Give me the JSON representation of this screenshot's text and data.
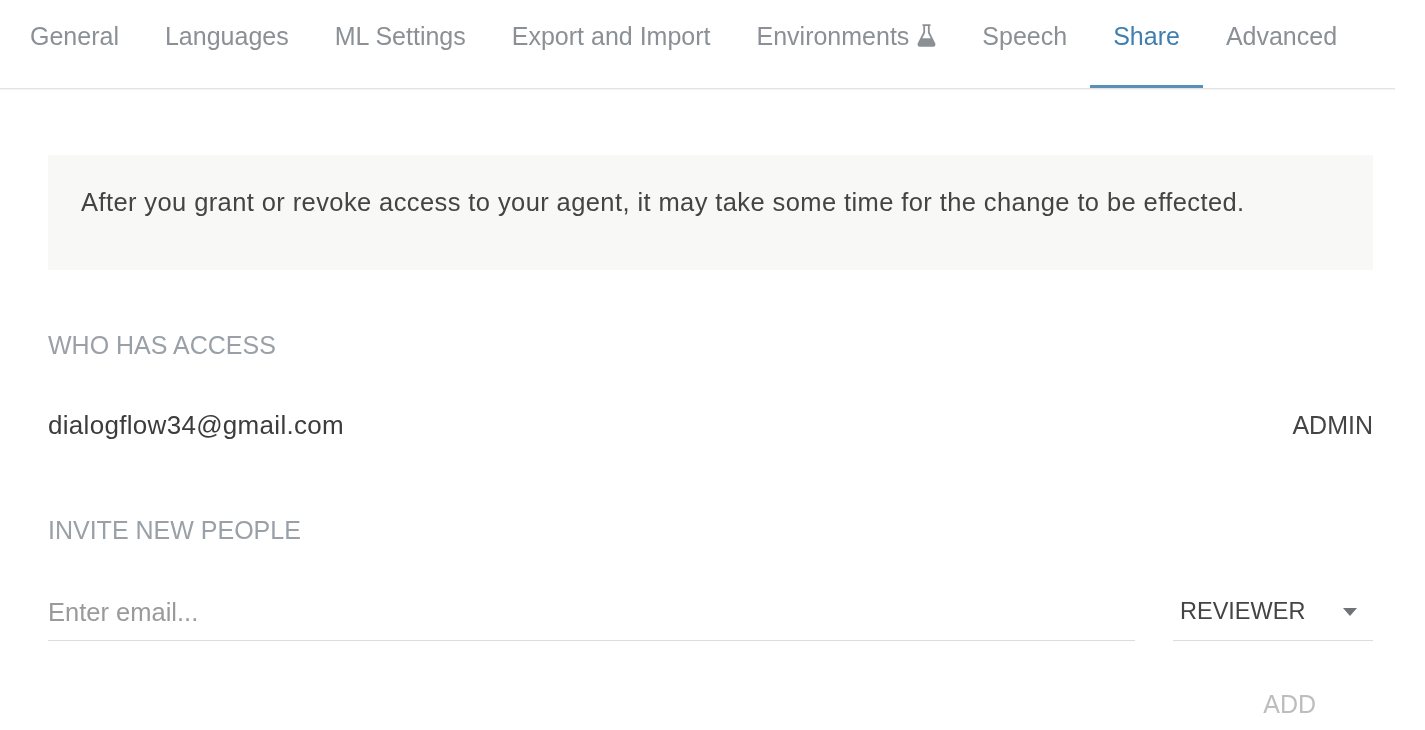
{
  "tabs": [
    {
      "label": "General",
      "selected": false,
      "has_icon": false
    },
    {
      "label": "Languages",
      "selected": false,
      "has_icon": false
    },
    {
      "label": "ML Settings",
      "selected": false,
      "has_icon": false
    },
    {
      "label": "Export and Import",
      "selected": false,
      "has_icon": false
    },
    {
      "label": "Environments",
      "selected": false,
      "has_icon": true
    },
    {
      "label": "Speech",
      "selected": false,
      "has_icon": false
    },
    {
      "label": "Share",
      "selected": true,
      "has_icon": false
    },
    {
      "label": "Advanced",
      "selected": false,
      "has_icon": false
    }
  ],
  "notice": {
    "text": "After you grant or revoke access to your agent, it may take some time for the change to be effected."
  },
  "access": {
    "heading": "WHO HAS ACCESS",
    "members": [
      {
        "email": "dialogflow34@gmail.com",
        "role": "ADMIN"
      }
    ]
  },
  "invite": {
    "heading": "INVITE NEW PEOPLE",
    "email_field": {
      "placeholder": "Enter email..."
    },
    "role_select": {
      "value": "REVIEWER"
    },
    "add_button": {
      "label": "ADD",
      "disabled": true
    }
  }
}
